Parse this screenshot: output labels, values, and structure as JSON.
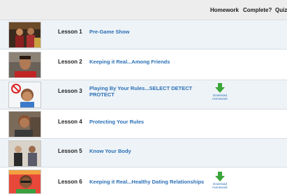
{
  "header": {
    "homework": "Homework",
    "complete": "Complete?",
    "quiz": "Quiz"
  },
  "lessons": [
    {
      "number": "Lesson 1",
      "title": "Pre-Game Show"
    },
    {
      "number": "Lesson 2",
      "title": "Keeping it Real...Among Friends"
    },
    {
      "number": "Lesson 3",
      "title": "Playing By Your Rules...SELECT DETECT PROTECT",
      "download": "Download Homework"
    },
    {
      "number": "Lesson 4",
      "title": "Protecting Your Rules"
    },
    {
      "number": "Lesson 5",
      "title": "Know Your Body"
    },
    {
      "number": "Lesson 6",
      "title": "Keeping it Real...Healthy Dating Relationships",
      "download": "Download Homework"
    }
  ],
  "colors": {
    "link": "#2a6fb6",
    "download_arrow": "#3aa63a",
    "row_alt": "#eef3f7"
  },
  "icons": {
    "download": "download-arrow-icon"
  }
}
